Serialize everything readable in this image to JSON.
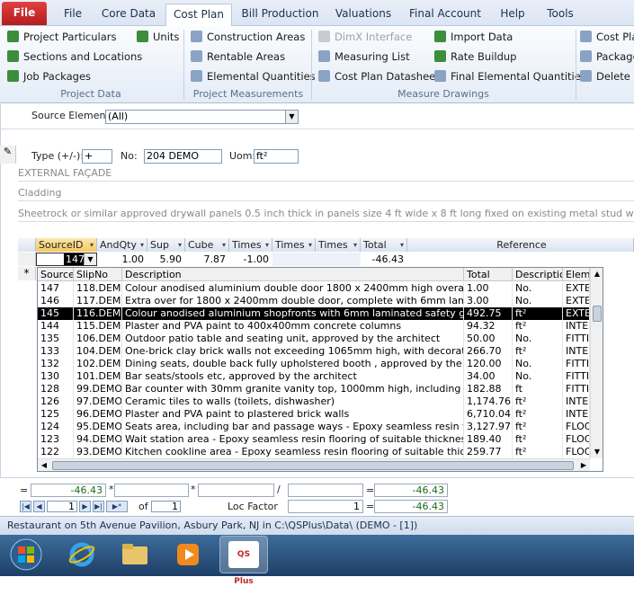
{
  "tabs": {
    "file": "File",
    "file2": "File",
    "core_data": "Core Data",
    "cost_plan": "Cost Plan",
    "bill_production": "Bill Production",
    "valuations": "Valuations",
    "final_account": "Final Account",
    "help": "Help",
    "tools": "Tools"
  },
  "ribbon": {
    "project_particulars": "Project Particulars",
    "units": "Units",
    "sections_locations": "Sections and Locations",
    "job_packages": "Job Packages",
    "group_project_data": "Project Data",
    "construction_areas": "Construction Areas",
    "rentable_areas": "Rentable Areas",
    "elemental_quantities": "Elemental Quantities",
    "group_project_measurements": "Project Measurements",
    "dimx_interface": "DimX Interface",
    "measuring_list": "Measuring List",
    "cost_plan_datasheet": "Cost Plan Datasheet",
    "import_data": "Import Data",
    "rate_buildup": "Rate Buildup",
    "final_elemental_quantities": "Final Elemental Quantities",
    "group_measure_drawings": "Measure Drawings",
    "cost_pla": "Cost Pla",
    "package": "Package",
    "delete_d": "Delete D"
  },
  "form": {
    "source_element_label": "Source Element:",
    "source_element_value": "(All)",
    "type_label": "Type (+/-):",
    "type_value": "+",
    "no_label": "No:",
    "no_value": "204  DEMO",
    "uom_label": "Uom:",
    "uom_value": "ft²",
    "memo1": "EXTERNAL FAÇADE",
    "memo2": "Cladding",
    "memo3": "Sheetrock or similar approved drywall panels 0.5 inch thick in panels size 4 ft wide x 8 ft long fixed on existing metal stud walls, both"
  },
  "grid": {
    "headers": {
      "source_id": "SourceID",
      "and_qty": "AndQty",
      "sup": "Sup",
      "cube": "Cube",
      "times1": "Times",
      "times2": "Times",
      "times3": "Times",
      "total": "Total",
      "reference": "Reference"
    },
    "row": {
      "source_id": "147",
      "and_qty": "1.00",
      "sup": "5.90",
      "cube": "7.87",
      "times1": "-1.00",
      "total": "-46.43"
    }
  },
  "list": {
    "headers": {
      "source": "Source",
      "slip_no": "SlipNo",
      "description": "Description",
      "total": "Total",
      "description2": "Descriptio",
      "elem": "Elem"
    },
    "rows": [
      {
        "source": "147",
        "slip": "118.DEMO",
        "desc": "Colour anodised aluminium double door 1800 x 2400mm high overall, wit",
        "total": "1.00",
        "unit": "No.",
        "elem": "EXTE"
      },
      {
        "source": "146",
        "slip": "117.DEMO",
        "desc": "Extra over for 1800 x 2400mm double door, complete with 6mm laminated",
        "total": "3.00",
        "unit": "No.",
        "elem": "EXTE"
      },
      {
        "source": "145",
        "slip": "116.DEMO",
        "desc": "Colour anodised aluminium shopfronts with 6mm laminated safety glass,",
        "total": "492.75",
        "unit": "ft²",
        "elem": "EXTE"
      },
      {
        "source": "144",
        "slip": "115.DEMO",
        "desc": "Plaster and PVA paint to 400x400mm concrete columns",
        "total": "94.32",
        "unit": "ft²",
        "elem": "INTE"
      },
      {
        "source": "135",
        "slip": "106.DEMO",
        "desc": "Outdoor patio table and seating unit, approved by the architect",
        "total": "50.00",
        "unit": "No.",
        "elem": "FITTI"
      },
      {
        "source": "133",
        "slip": "104.DEMO",
        "desc": "One-brick clay brick walls not exceeding 1065mm high, with decorative st",
        "total": "266.70",
        "unit": "ft²",
        "elem": "INTE"
      },
      {
        "source": "132",
        "slip": "102.DEMO",
        "desc": "Dining seats, double back fully upholstered booth , approved by the arch",
        "total": "120.00",
        "unit": "No.",
        "elem": "FITTI"
      },
      {
        "source": "130",
        "slip": "101.DEMO",
        "desc": "Bar seats/stools etc, approved by the architect",
        "total": "34.00",
        "unit": "No.",
        "elem": "FITTI"
      },
      {
        "source": "128",
        "slip": "99.DEMO",
        "desc": "Bar counter with 30mm granite vanity top, 1000mm high, including cupbo",
        "total": "182.88",
        "unit": "ft",
        "elem": "FITTI"
      },
      {
        "source": "126",
        "slip": "97.DEMO",
        "desc": "Ceramic tiles to walls (toilets, dishwasher)",
        "total": "1,174.76",
        "unit": "ft²",
        "elem": "INTE"
      },
      {
        "source": "125",
        "slip": "96.DEMO",
        "desc": "Plaster and PVA paint to plastered brick walls",
        "total": "6,710.04",
        "unit": "ft²",
        "elem": "INTE"
      },
      {
        "source": "124",
        "slip": "95.DEMO",
        "desc": "Seats area, including bar and passage ways - Epoxy seamless resin floorin",
        "total": "3,127.97",
        "unit": "ft²",
        "elem": "FLOC"
      },
      {
        "source": "123",
        "slip": "94.DEMO",
        "desc": "Wait station area - Epoxy seamless resin flooring of suitable thickness, co",
        "total": "189.40",
        "unit": "ft²",
        "elem": "FLOC"
      },
      {
        "source": "122",
        "slip": "93.DEMO",
        "desc": "Kitchen cookline area - Epoxy seamless resin flooring of suitable thicknes",
        "total": "259.77",
        "unit": "ft²",
        "elem": "FLOC"
      }
    ]
  },
  "footer": {
    "sum1": "-46.43",
    "sum2": "-46.43",
    "record_current": "1",
    "record_of": "of",
    "record_total": "1",
    "loc_factor_label": "Loc Factor",
    "loc_factor_value": "1",
    "eq": "=",
    "star": "*",
    "slash": "/"
  },
  "status": "Restaurant on 5th Avenue Pavilion, Asbury Park, NJ in C:\\QSPlus\\Data\\ (DEMO - [1])",
  "taskbar": {
    "app_label": "QS Plus"
  }
}
